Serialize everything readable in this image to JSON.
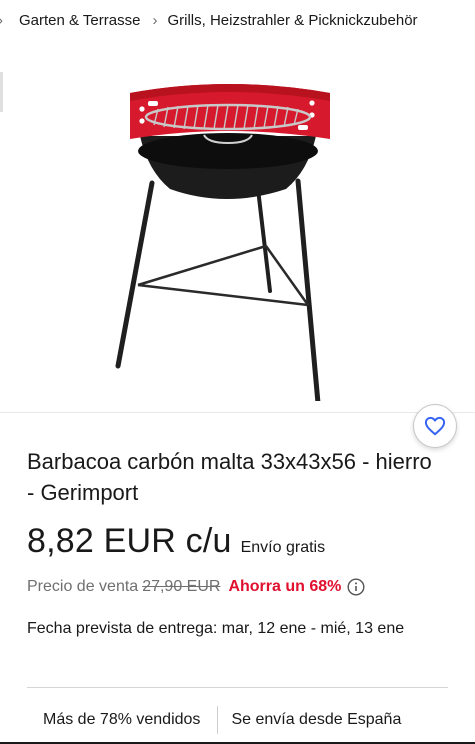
{
  "breadcrumb": {
    "items": [
      "Garten & Terrasse",
      "Grills, Heizstrahler & Picknickzubehör"
    ]
  },
  "product": {
    "image_alt": "Barbacoa carbón malta",
    "title": "Barbacoa carbón malta 33x43x56 - hierro - Gerimport",
    "price": "8,82 EUR c/u",
    "shipping": "Envío gratis",
    "was_label": "Precio de venta",
    "was_price": "27,90 EUR",
    "savings": "Ahorra un 68%",
    "delivery": "Fecha prevista de entrega: mar, 12 ene - mié, 13 ene"
  },
  "stats": {
    "sold": "Más de 78% vendidos",
    "ships_from": "Se envía desde España"
  },
  "colors": {
    "accent_blue": "#3665f3",
    "savings_red": "#e0102e",
    "grill_red": "#d7192d"
  }
}
